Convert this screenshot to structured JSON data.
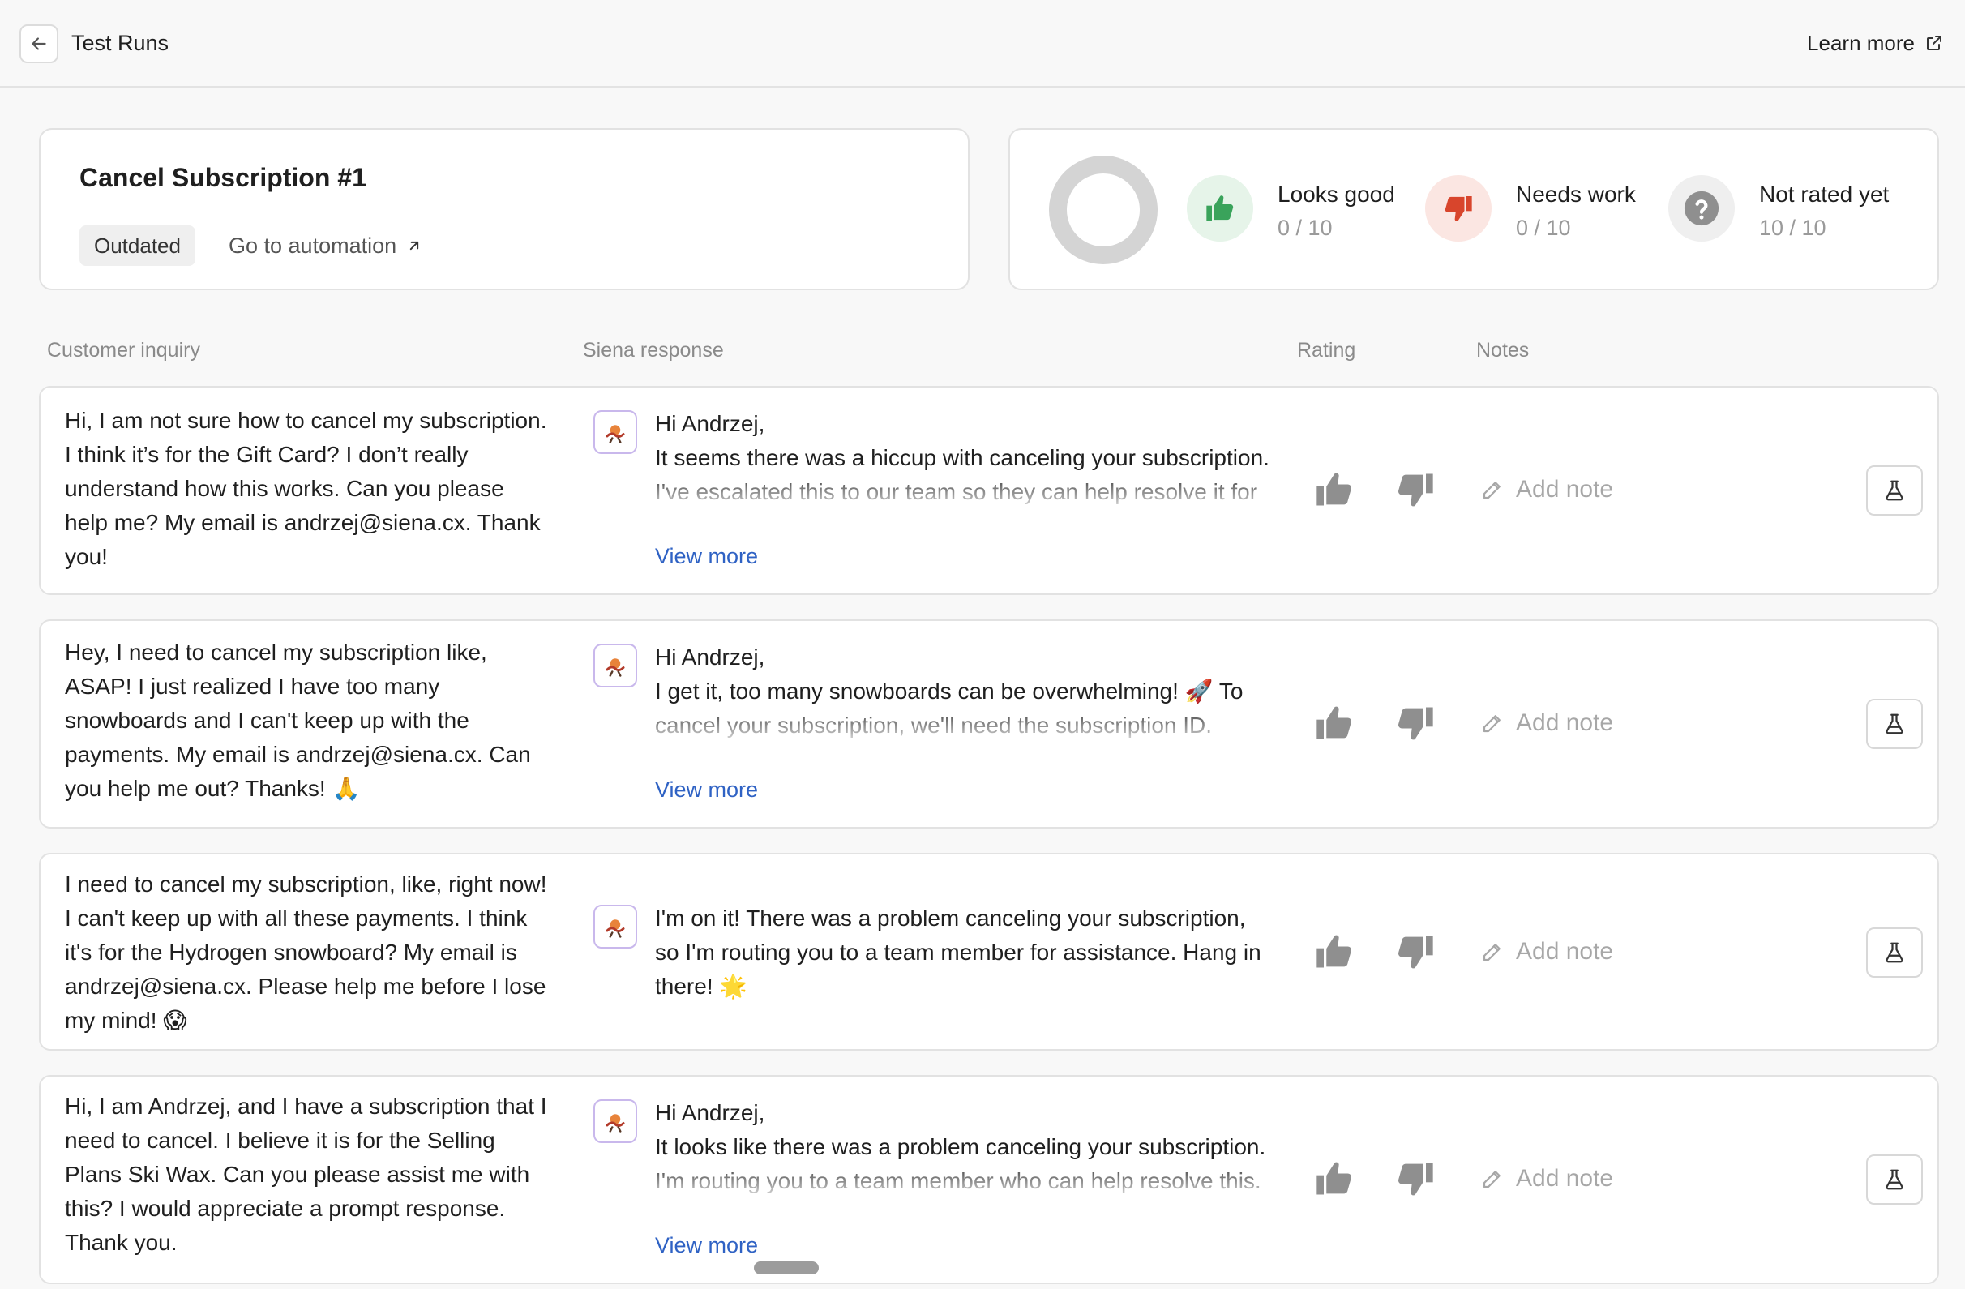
{
  "header": {
    "title": "Test Runs",
    "learn_more": "Learn more"
  },
  "test": {
    "title": "Cancel Subscription #1",
    "status_badge": "Outdated",
    "automation_link": "Go to automation"
  },
  "stats": {
    "looks_good": {
      "label": "Looks good",
      "value": "0 / 10"
    },
    "needs_work": {
      "label": "Needs work",
      "value": "0 / 10"
    },
    "not_rated": {
      "label": "Not rated yet",
      "value": "10 / 10"
    }
  },
  "columns": {
    "inquiry": "Customer inquiry",
    "response": "Siena response",
    "rating": "Rating",
    "notes": "Notes"
  },
  "rows": [
    {
      "inquiry": "Hi, I am not sure how to cancel my subscription. I think it’s for the Gift Card? I don’t really understand how this works. Can you please help me? My email is andrzej@siena.cx. Thank you!",
      "response_lines": [
        "Hi Andrzej,",
        "It seems there was a hiccup with canceling your subscription. I've escalated this to our team so they can help resolve it for you. Hang tight, and we'll get this"
      ],
      "view_more": "View more",
      "add_note": "Add note"
    },
    {
      "inquiry": "Hey, I need to cancel my subscription like, ASAP! I just realized I have too many snowboards and I can't keep up with the payments. My email is andrzej@siena.cx. Can you help me out? Thanks! 🙏",
      "response_lines": [
        "Hi Andrzej,",
        "I get it, too many snowboards can be overwhelming! 🚀 To cancel your subscription, we'll need the subscription ID. Could you please provide that? Once we have it, we'll get"
      ],
      "view_more": "View more",
      "add_note": "Add note"
    },
    {
      "inquiry": "I need to cancel my subscription, like, right now! I can't keep up with all these payments. I think it's for the Hydrogen snowboard? My email is andrzej@siena.cx. Please help me before I lose my mind! 😱",
      "response_lines": [
        "I'm on it! There was a problem canceling your subscription, so I'm routing you to a team member for assistance. Hang in there! 🌟"
      ],
      "add_note": "Add note"
    },
    {
      "inquiry": "Hi, I am Andrzej, and I have a subscription that I need to cancel. I believe it is for the Selling Plans Ski Wax. Can you please assist me with this? I would appreciate a prompt response. Thank you.",
      "response_lines": [
        "Hi Andrzej,",
        "It looks like there was a problem canceling your subscription. I'm routing you to a team member who can help resolve this. Hang tight! We'll get it sorted for you."
      ],
      "view_more": "View more",
      "add_note": "Add note"
    }
  ],
  "colors": {
    "accent_link": "#2f62c4",
    "good_green": "#3aa35b",
    "bad_red": "#d8452c",
    "neutral_gray": "#8f8f8f"
  }
}
